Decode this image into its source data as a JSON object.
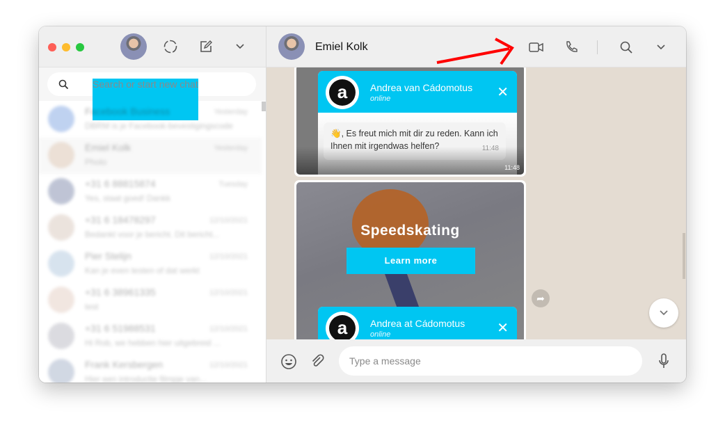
{
  "sidebar": {
    "search_placeholder": "Search or start new chat",
    "chats": [
      {
        "name": "Facebook Business",
        "time": "Yesterday",
        "message": "DBRM is je Facebook-bevestigingscode"
      },
      {
        "name": "Emiel Kolk",
        "time": "Yesterday",
        "message": "Photo"
      },
      {
        "name": "+31 6 88815874",
        "time": "Tuesday",
        "message": "Yes, staat goed! Dankk"
      },
      {
        "name": "+31 6 18478297",
        "time": "12/10/2021",
        "message": "Bedankt voor je bericht. Dit bericht..."
      },
      {
        "name": "Pier Stelijn",
        "time": "12/10/2021",
        "message": "Kan je even testen of dat werkt"
      },
      {
        "name": "+31 6 38961335",
        "time": "12/10/2021",
        "message": "test"
      },
      {
        "name": "+31 6 51988531",
        "time": "12/10/2021",
        "message": "Hi Rob, we hebben hier uitgebreid ..."
      },
      {
        "name": "Frank Kersbergen",
        "time": "12/10/2021",
        "message": "Hier een introductie filmpje van..."
      }
    ]
  },
  "chat": {
    "contact_name": "Emiel Kolk",
    "composer_placeholder": "Type a message",
    "message1": {
      "popup_name": "Andrea van Cádomotus",
      "popup_status": "online",
      "bubble_text": "👋, Es freut mich mit dir zu reden. Kann ich Ihnen mit irgendwas helfen?",
      "bubble_time": "11:48",
      "image_time": "11:48"
    },
    "message2": {
      "headline": "Speedskating",
      "button": "Learn more",
      "popup_name": "Andrea at Cádomotus",
      "popup_status": "online",
      "logo_letter": "a"
    }
  },
  "colors": {
    "accent": "#00c6f2",
    "annotation_arrow": "#ff0000"
  }
}
